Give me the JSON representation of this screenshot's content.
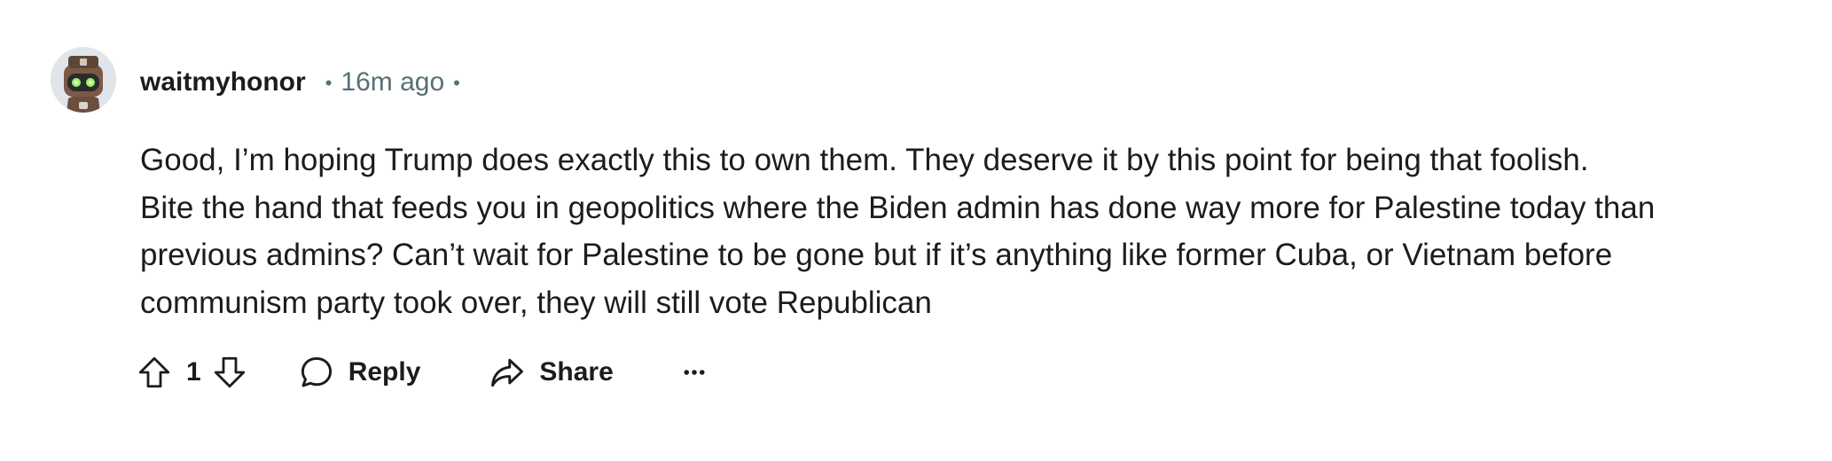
{
  "comment": {
    "username": "waitmyhonor",
    "separator": "•",
    "timestamp": "16m ago",
    "body_lines": [
      "Good, I’m hoping Trump does exactly this to own them. They deserve it by this point for being that foolish.",
      "Bite the hand that feeds you in geopolitics where the Biden admin has done way more for Palestine today than",
      "previous admins? Can’t wait for Palestine to be gone but if it’s anything like former Cuba, or Vietnam before",
      "communism party took over, they will still vote Republican"
    ],
    "avatar_icon": "robot-snoo-avatar"
  },
  "actions": {
    "upvote_icon": "arrow-up-icon",
    "score": "1",
    "downvote_icon": "arrow-down-icon",
    "reply_icon": "speech-bubble-icon",
    "reply_label": "Reply",
    "share_icon": "share-arrow-icon",
    "share_label": "Share",
    "more_icon": "ellipsis-icon"
  },
  "colors": {
    "text_primary": "#1c1c1c",
    "text_secondary": "#576f76",
    "background": "#ffffff"
  }
}
